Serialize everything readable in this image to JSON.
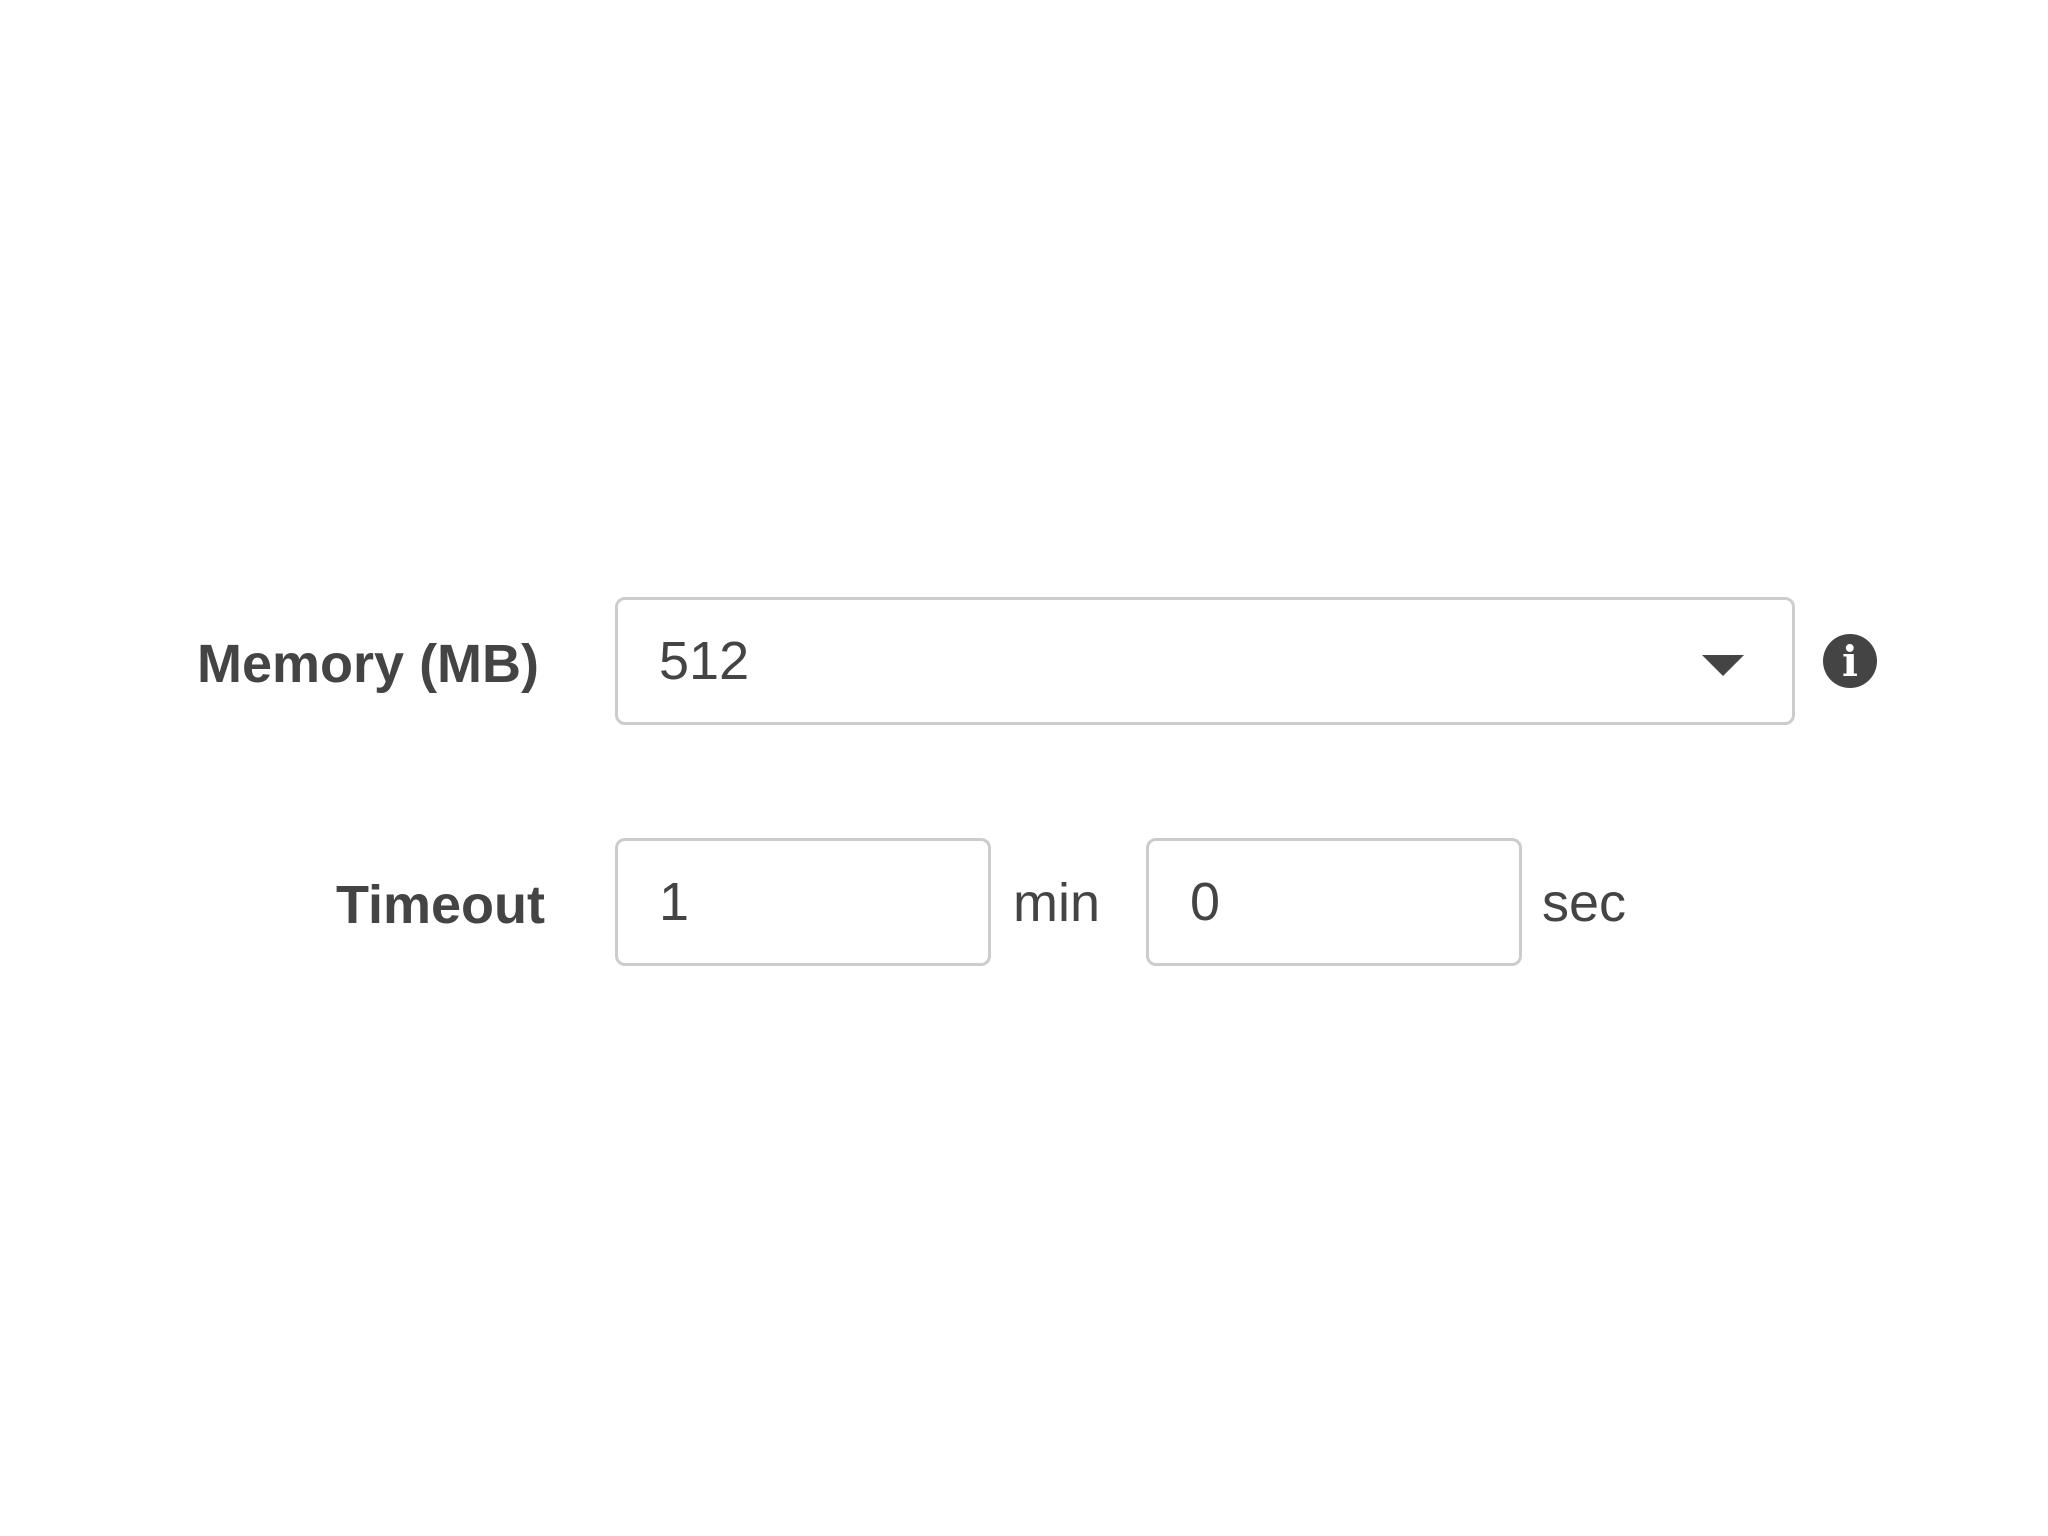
{
  "memory": {
    "label": "Memory (MB)",
    "selected_value": "512",
    "info_icon": "info-icon"
  },
  "timeout": {
    "label": "Timeout",
    "minutes_value": "1",
    "minutes_unit": "min",
    "seconds_value": "0",
    "seconds_unit": "sec"
  },
  "colors": {
    "text": "#444444",
    "border": "#cccccc",
    "background": "#ffffff"
  }
}
